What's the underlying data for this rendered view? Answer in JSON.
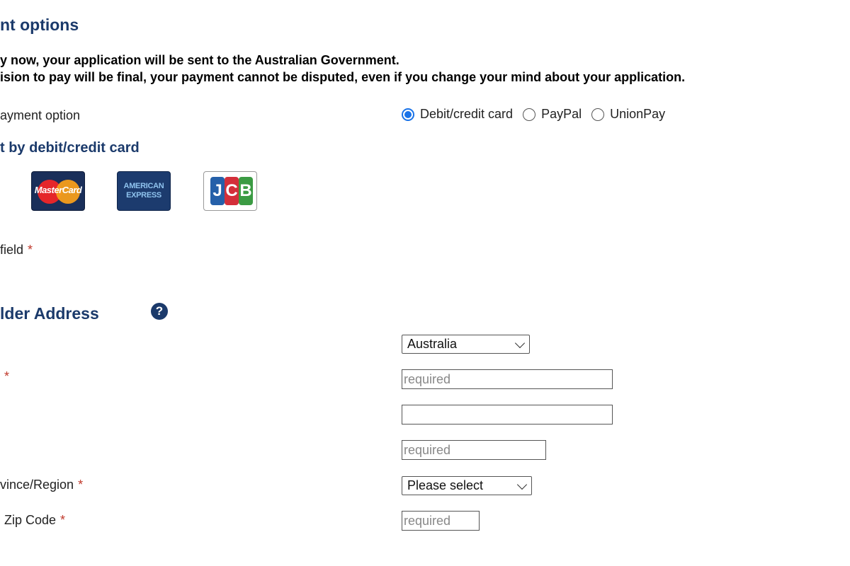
{
  "section_title": "nt options",
  "notice": {
    "line1": "y now, your application will be sent to the Australian Government.",
    "line2": "ision to pay will be final, your payment cannot be disputed, even if you change your mind about your application."
  },
  "payment_option": {
    "label": "ayment option",
    "options": [
      {
        "label": "Debit/credit card",
        "selected": true
      },
      {
        "label": "PayPal",
        "selected": false
      },
      {
        "label": "UnionPay",
        "selected": false
      }
    ]
  },
  "card_section": {
    "title": "t by debit/credit card",
    "logos": [
      {
        "name": "mastercard-logo",
        "text": "MasterCard"
      },
      {
        "name": "american-express-logo",
        "line1": "AMERICAN",
        "line2": "EXPRESS"
      },
      {
        "name": "jcb-logo",
        "letters": [
          "J",
          "C",
          "B"
        ]
      }
    ]
  },
  "required_note": {
    "label": "field",
    "mark": "*"
  },
  "address": {
    "title": "lder Address",
    "help_icon": "?",
    "country": {
      "value": "Australia"
    },
    "address1": {
      "mark": "*",
      "placeholder": "required"
    },
    "address2": {
      "value": ""
    },
    "city": {
      "placeholder": "required"
    },
    "state": {
      "label": "vince/Region",
      "mark": "*",
      "value": "Please select"
    },
    "zip": {
      "label": "Zip Code",
      "mark": "*",
      "placeholder": "required"
    }
  },
  "colors": {
    "heading": "#1b3a6b",
    "required_mark": "#c0392b",
    "radio_selected": "#1a73e8"
  }
}
